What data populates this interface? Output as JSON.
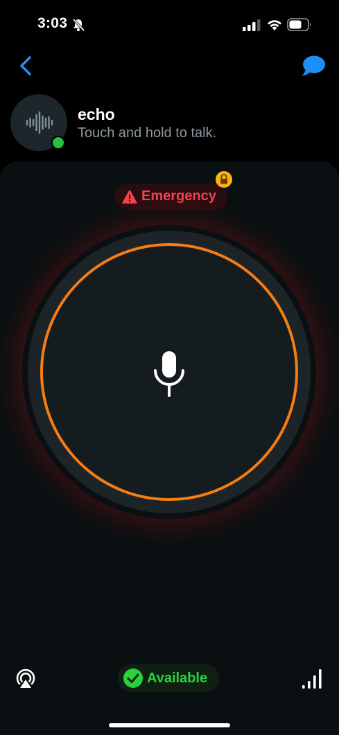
{
  "status_bar": {
    "time": "3:03"
  },
  "nav": {
    "back_icon": "chevron-left-icon",
    "chat_icon": "speech-bubble-icon",
    "accent_color": "#1e8ef7"
  },
  "channel": {
    "title": "echo",
    "subtitle": "Touch and hold to talk.",
    "avatar_icon": "waveform-icon",
    "presence": "online",
    "presence_color": "#22c43b"
  },
  "emergency": {
    "label": "Emergency",
    "icon": "warning-triangle-icon",
    "badge_icon": "lock-icon",
    "color": "#f0454e",
    "badge_color": "#f7b215"
  },
  "talk_button": {
    "icon": "microphone-icon",
    "ring_color": "#f57d11"
  },
  "bottom_bar": {
    "left_icon": "airplay-icon",
    "status_label": "Available",
    "status_icon": "checkmark-circle-icon",
    "status_color": "#2ad13f",
    "right_icon": "signal-bars-icon"
  }
}
